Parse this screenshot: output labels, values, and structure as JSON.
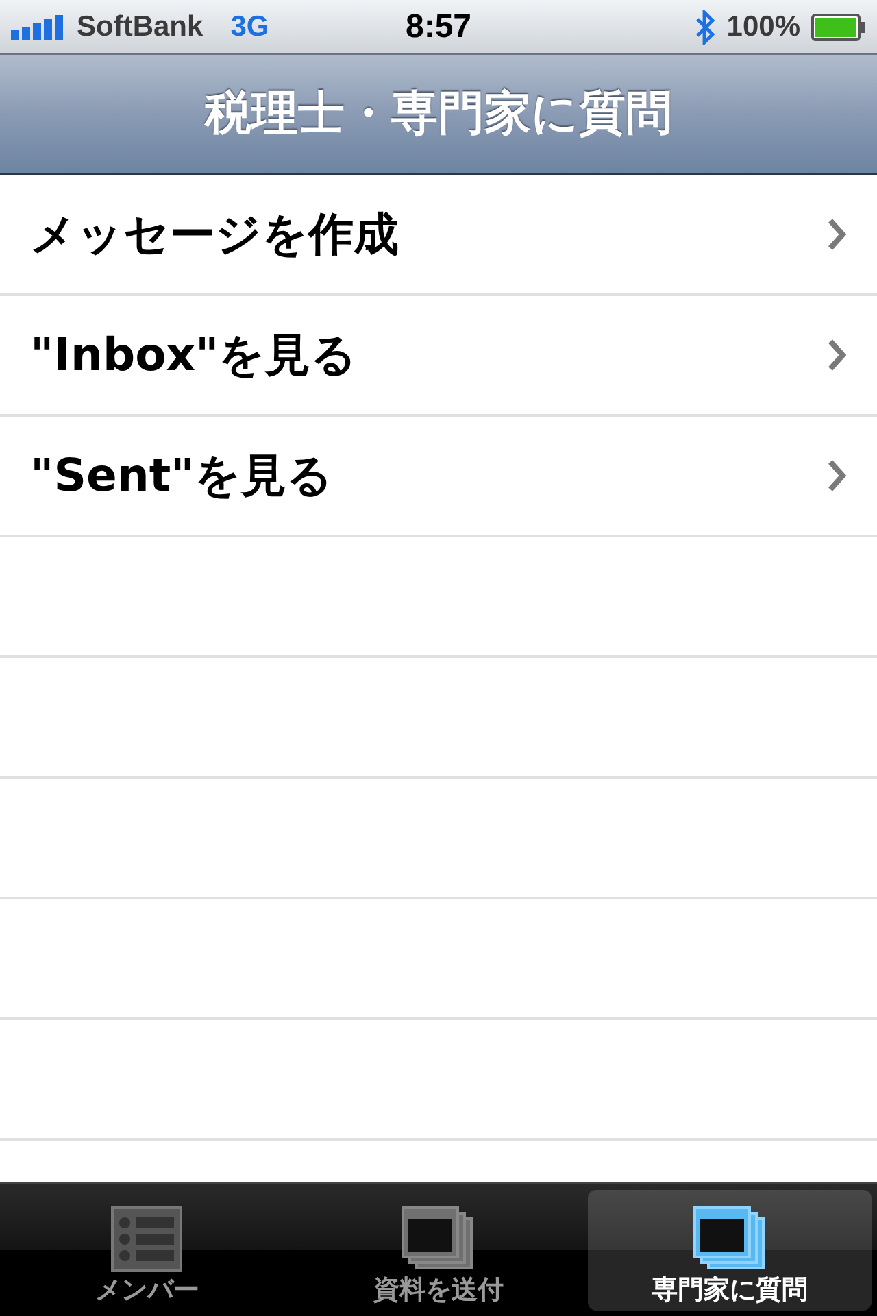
{
  "status_bar": {
    "carrier": "SoftBank",
    "network": "3G",
    "time": "8:57",
    "battery": "100%"
  },
  "nav_bar": {
    "title": "税理士・専門家に質問"
  },
  "menu": [
    {
      "label": "メッセージを作成"
    },
    {
      "label": "\"Inbox\"を見る"
    },
    {
      "label": "\"Sent\"を見る"
    }
  ],
  "tab_bar": [
    {
      "label": "メンバー",
      "kind": "list",
      "selected": false
    },
    {
      "label": "資料を送付",
      "kind": "windows",
      "selected": false
    },
    {
      "label": "専門家に質問",
      "kind": "windows",
      "selected": true
    }
  ]
}
